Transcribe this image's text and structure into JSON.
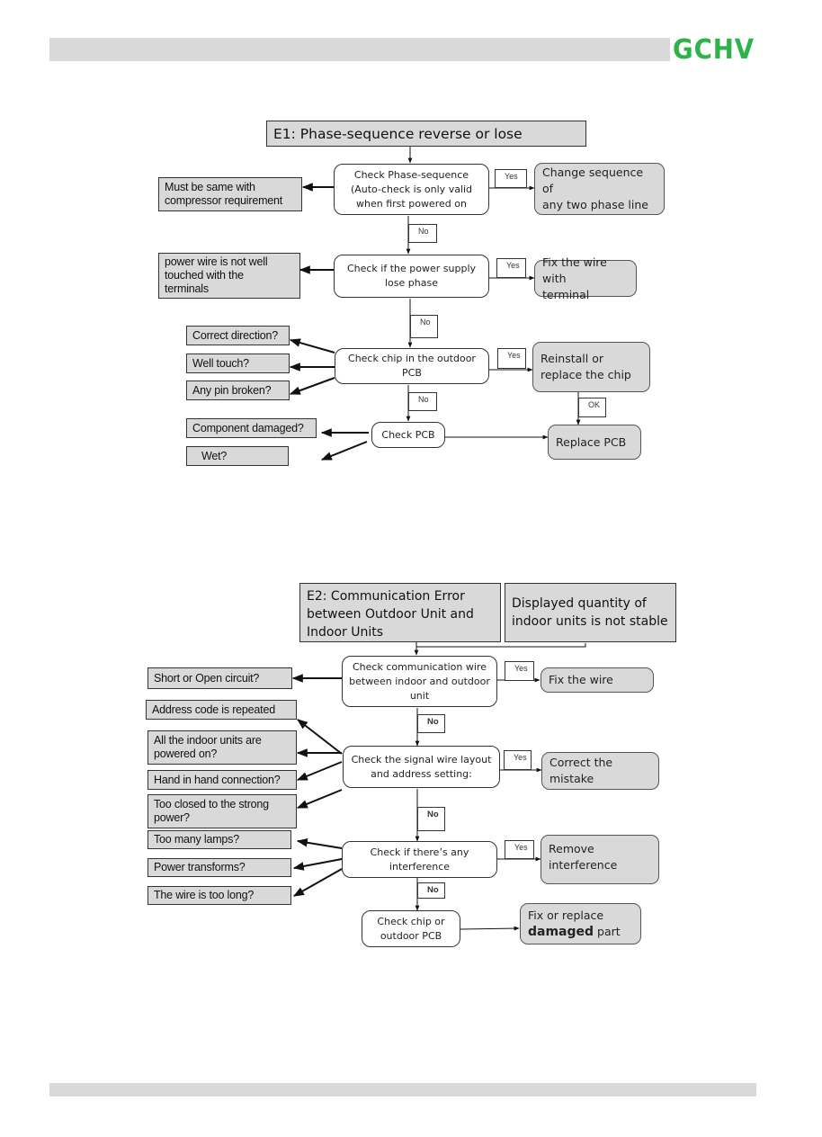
{
  "header": {
    "logo_text": "GCHV",
    "brand_color": "#2db34a"
  },
  "e1": {
    "title": "E1: Phase-sequence reverse or lose",
    "step1": {
      "line1": "Check Phase-sequence",
      "line2": "(Auto-check is only valid",
      "line3": "when first powered on"
    },
    "step1_yes": {
      "line1": "Change sequence  of",
      "line2": "any two phase line"
    },
    "step1_cause": {
      "line1": "Must be same with",
      "line2": "compressor requirement"
    },
    "step2": {
      "line1": "Check if the power supply",
      "line2": "lose phase"
    },
    "step2_yes": {
      "line1": "Fix the wire with",
      "line2": "terminal"
    },
    "step2_cause": {
      "line1": "power wire is not well",
      "line2": "touched with  the",
      "line3": "terminals"
    },
    "step3": {
      "line1": "Check chip in the outdoor",
      "line2": "PCB"
    },
    "step3_yes": {
      "line1": "Reinstall  or",
      "line2": "replace  the chip"
    },
    "step3_causes": [
      "Correct direction?",
      "Well touch?",
      "Any pin broken?"
    ],
    "step4": {
      "label": "Check PCB"
    },
    "step4_result": "Replace  PCB",
    "step4_causes": [
      "Component damaged?",
      "Wet?"
    ],
    "tags": {
      "yes1": "Yes",
      "no1": "No",
      "yes2": "Yes",
      "no2": "No",
      "yes3": "Yes",
      "no3": "No",
      "ok": "OK"
    }
  },
  "e2": {
    "title": {
      "line1": "E2: Communication Error",
      "line2": "between Outdoor Unit and",
      "line3": "Indoor Units"
    },
    "side_title": {
      "line1": "Displayed quantity of",
      "line2": "indoor units is not stable"
    },
    "step1": {
      "line1": "Check communication wire",
      "line2": "between indoor and outdoor",
      "line3": "unit"
    },
    "step1_yes": "Fix the wire",
    "step1_cause": "Short or Open circuit?",
    "step2": {
      "line1": "Check the signal wire layout",
      "line2": "and address setting:"
    },
    "step2_yes": {
      "line1": "Correct   the",
      "line2": "mistake"
    },
    "step2_causes": [
      {
        "line1": "Address code is repeated",
        "line2": ""
      },
      {
        "line1": "All the indoor units are",
        "line2": "powered on?"
      },
      {
        "line1": "Hand in hand connection?",
        "line2": ""
      },
      {
        "line1": "Too closed to the strong",
        "line2": "power?"
      }
    ],
    "step3": {
      "line1": "Check if there’s any",
      "line2": "interference"
    },
    "step3_yes": {
      "line1": "Remove",
      "line2": "interference"
    },
    "step3_causes": [
      "Too many lamps?",
      "Power transforms?",
      "The wire is too long?"
    ],
    "step4": {
      "line1": "Check chip or",
      "line2": "outdoor PCB"
    },
    "step4_result": {
      "line1": "Fix or replace",
      "bold": "damaged",
      "rest": " part"
    },
    "tags": {
      "yes1": "Yes",
      "no1": "No",
      "yes2": "Yes",
      "no2": "No",
      "yes3": "Yes",
      "no3": "No"
    }
  }
}
